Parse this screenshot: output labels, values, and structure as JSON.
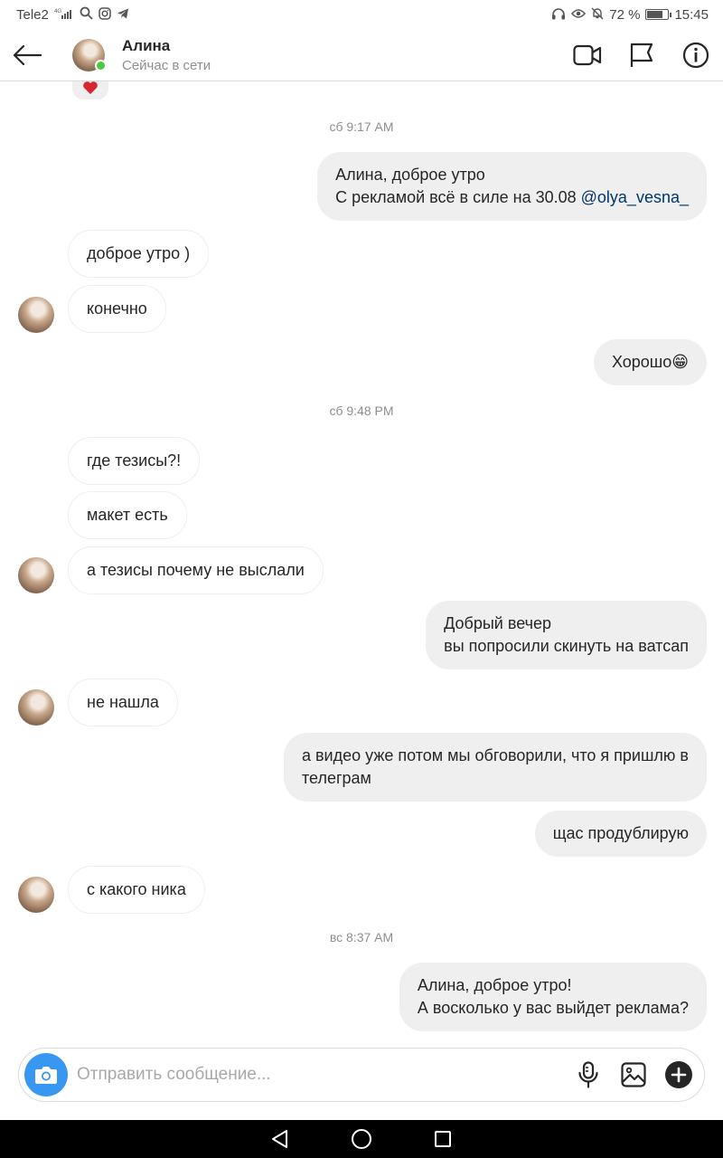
{
  "status_bar": {
    "carrier": "Tele2",
    "network": "4G",
    "battery_percent": "72 %",
    "time": "15:45"
  },
  "header": {
    "name": "Алина",
    "status": "Сейчас в сети"
  },
  "messages": [
    {
      "type": "timestamp",
      "text": "сб 9:17 AM"
    },
    {
      "type": "outgoing",
      "lines": [
        "Алина, доброе утро",
        "С рекламой всё в силе на 30.08 "
      ],
      "mention": "@olya_vesna_"
    },
    {
      "type": "incoming",
      "text": "доброе утро )"
    },
    {
      "type": "incoming",
      "text": "конечно"
    },
    {
      "type": "outgoing",
      "text": "Хорошо😁"
    },
    {
      "type": "timestamp",
      "text": "сб 9:48 PM"
    },
    {
      "type": "incoming",
      "text": "где тезисы?!"
    },
    {
      "type": "incoming",
      "text": "макет есть"
    },
    {
      "type": "incoming",
      "text": "а тезисы почему не выслали"
    },
    {
      "type": "outgoing",
      "lines": [
        "Добрый вечер",
        "вы попросили скинуть на ватсап"
      ]
    },
    {
      "type": "incoming",
      "text": "не нашла"
    },
    {
      "type": "outgoing",
      "lines": [
        "а видео уже потом мы обговорили, что я пришлю в",
        "телеграм"
      ]
    },
    {
      "type": "outgoing",
      "text": "щас продублирую"
    },
    {
      "type": "incoming",
      "text": "с какого ника"
    },
    {
      "type": "timestamp",
      "text": "вс 8:37 AM"
    },
    {
      "type": "outgoing",
      "lines": [
        "Алина, доброе утро!",
        "А восколько у вас выйдет реклама?"
      ]
    }
  ],
  "composer": {
    "placeholder": "Отправить сообщение..."
  },
  "colors": {
    "accent": "#3897f0",
    "online": "#4bc93f",
    "outgoing_bubble": "#efefef",
    "mention": "#00376b",
    "heart": "#ed4956"
  }
}
